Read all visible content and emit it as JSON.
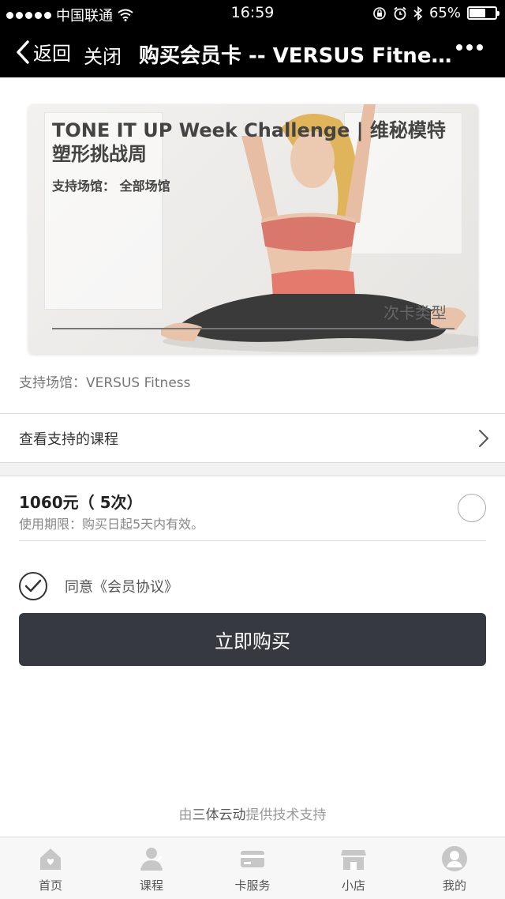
{
  "status_bar": {
    "carrier": "中国联通",
    "time": "16:59",
    "battery": "65%",
    "battery_level": 0.65,
    "icons": [
      "signal-dots-icon",
      "wifi-icon",
      "rotation-lock-icon",
      "alarm-icon",
      "bluetooth-icon",
      "battery-icon"
    ]
  },
  "nav": {
    "back_label": "返回",
    "close_label": "关闭",
    "title": "购买会员卡 -- VERSUS Fitne...",
    "icons": [
      "chevron-left-icon",
      "more-icon"
    ]
  },
  "card": {
    "title": "TONE IT UP Week Challenge | 维秘模特塑形挑战周",
    "venue": "支持场馆：  全部场馆",
    "type_label": "次卡类型"
  },
  "venue_line": "支持场馆：VERSUS Fitness",
  "courses_row": {
    "label": "查看支持的课程",
    "icon": "chevron-right-icon"
  },
  "option": {
    "price": "1060元（ 5次）",
    "validity": "使用期限：购买日起5天内有效。",
    "selected": false
  },
  "agreement": {
    "text": "同意《会员协议》",
    "checked": true
  },
  "buy_button": "立即购买",
  "powered_by": {
    "prefix": "由",
    "brand": "三体云动",
    "suffix": "提供技术支持"
  },
  "tabbar": [
    {
      "label": "首页",
      "icon": "home-icon"
    },
    {
      "label": "课程",
      "icon": "course-person-icon"
    },
    {
      "label": "卡服务",
      "icon": "card-icon"
    },
    {
      "label": "小店",
      "icon": "shop-icon"
    },
    {
      "label": "我的",
      "icon": "profile-icon"
    }
  ],
  "colors": {
    "nav_bg": "#000000",
    "button_bg": "#363940",
    "page_bg": "#ffffff",
    "divider_bg": "#f2f2f2"
  }
}
